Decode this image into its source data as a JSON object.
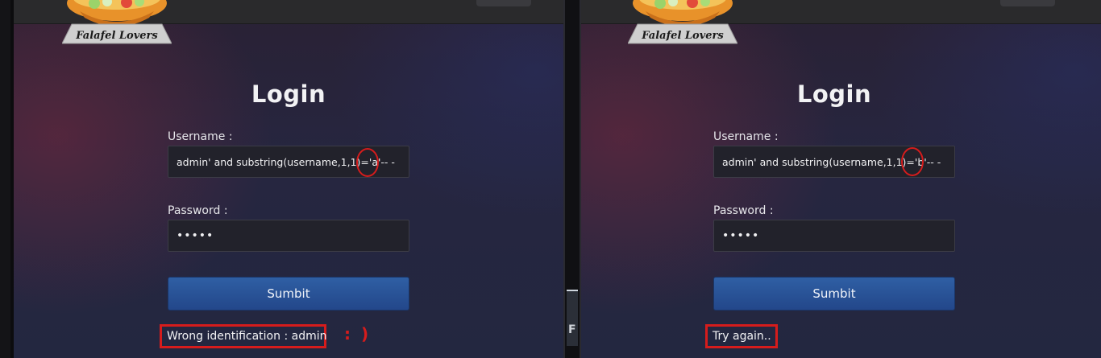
{
  "left_panel": {
    "brand": "Falafel Lovers",
    "title": "Login",
    "username_label": "Username :",
    "username_value": "admin' and substring(username,1,1)='a'-- -",
    "password_label": "Password :",
    "password_value": "•••••",
    "submit_label": "Sumbit",
    "result_message": "Wrong identification : admin",
    "annotation": ": )"
  },
  "right_panel": {
    "brand": "Falafel Lovers",
    "title": "Login",
    "username_label": "Username :",
    "username_value": "admin' and substring(username,1,1)='b'-- -",
    "password_label": "Password :",
    "password_value": "•••••",
    "submit_label": "Sumbit",
    "result_message": "Try again.."
  },
  "middle_fragment_glyph": "F",
  "colors": {
    "annotation_red": "#d61c1c",
    "button_blue": "#2f5fa4",
    "topbar": "#2a2a2c"
  }
}
